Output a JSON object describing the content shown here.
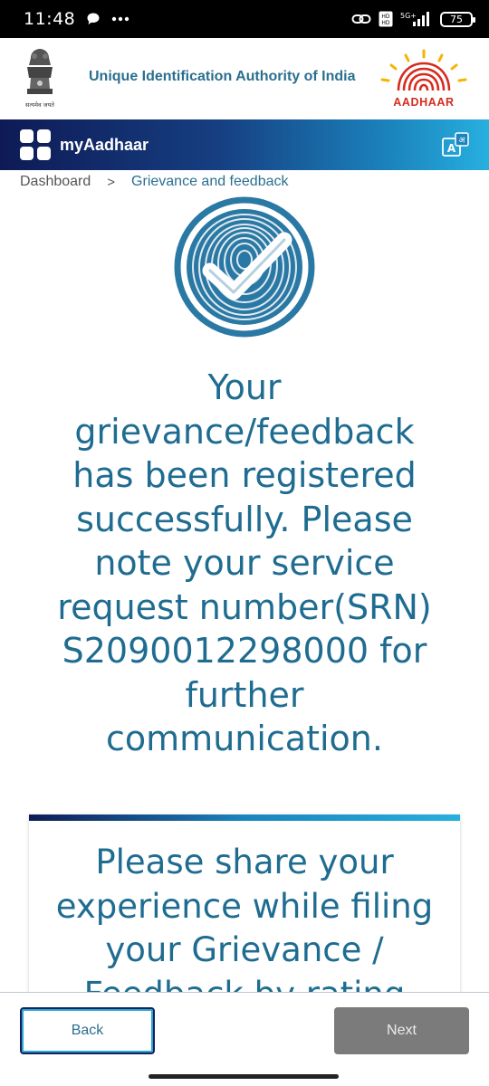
{
  "status_bar": {
    "time": "11:48",
    "battery": "75",
    "icons": [
      "chat-icon",
      "more-dots-icon",
      "link-icon",
      "volte-icon",
      "5g-signal-icon",
      "battery-icon"
    ]
  },
  "header": {
    "title": "Unique Identification Authority of India",
    "emblem_motto": "सत्यमेव जयते",
    "logo_text": "AADHAAR"
  },
  "navbar": {
    "title": "myAadhaar"
  },
  "breadcrumb": {
    "home": "Dashboard",
    "separator": ">",
    "current": "Grievance and feedback"
  },
  "message": {
    "lines": [
      "Your",
      "grievance/feedback",
      "has been registered",
      "successfully. Please",
      "note your service",
      "request number(SRN)",
      "S2090012298000 for",
      "further",
      "communication."
    ]
  },
  "feedback_card": {
    "lines": [
      "Please share your",
      "experience while filing",
      "your Grievance /",
      "Feedback by rating"
    ]
  },
  "footer": {
    "back_label": "Back",
    "next_label": "Next"
  },
  "colors": {
    "primary_text": "#1f6c91",
    "nav_gradient_start": "#0e1a55",
    "nav_gradient_end": "#27b0df",
    "logo_red": "#d62b1f",
    "logo_yellow": "#f6b400",
    "next_disabled": "#7b7b7b"
  }
}
